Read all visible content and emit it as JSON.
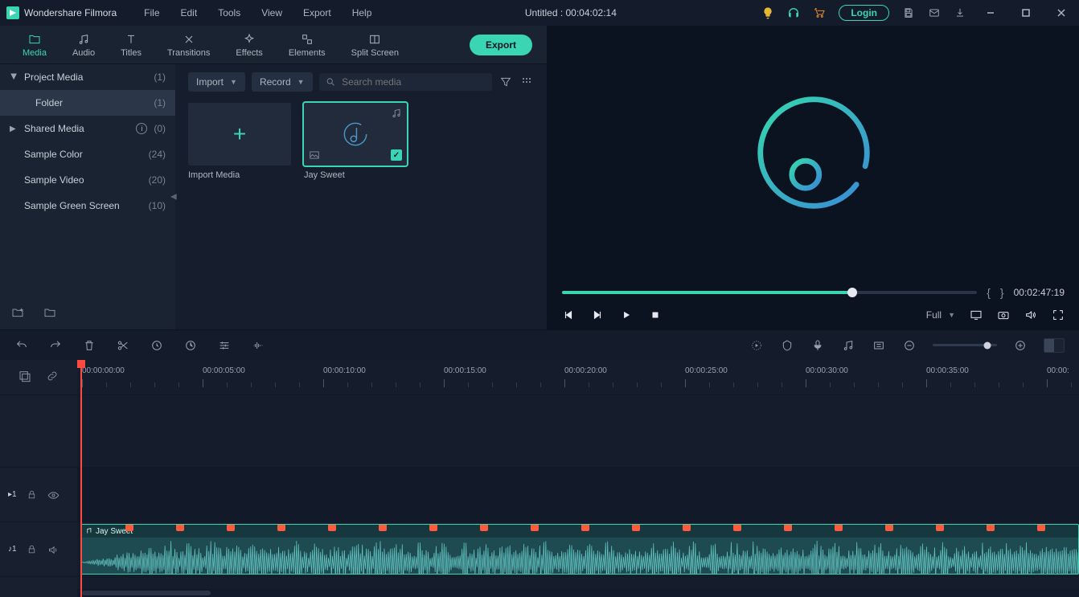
{
  "app": {
    "name": "Wondershare Filmora"
  },
  "menus": [
    "File",
    "Edit",
    "Tools",
    "View",
    "Export",
    "Help"
  ],
  "title_center": "Untitled : 00:04:02:14",
  "login_label": "Login",
  "tabs": [
    {
      "id": "media",
      "label": "Media"
    },
    {
      "id": "audio",
      "label": "Audio"
    },
    {
      "id": "titles",
      "label": "Titles"
    },
    {
      "id": "transitions",
      "label": "Transitions"
    },
    {
      "id": "effects",
      "label": "Effects"
    },
    {
      "id": "elements",
      "label": "Elements"
    },
    {
      "id": "split",
      "label": "Split Screen"
    }
  ],
  "active_tab": "media",
  "export_label": "Export",
  "tree": {
    "project": {
      "label": "Project Media",
      "count": "(1)"
    },
    "folder": {
      "label": "Folder",
      "count": "(1)"
    },
    "shared": {
      "label": "Shared Media",
      "count": "(0)"
    },
    "sample_color": {
      "label": "Sample Color",
      "count": "(24)"
    },
    "sample_video": {
      "label": "Sample Video",
      "count": "(20)"
    },
    "sample_green": {
      "label": "Sample Green Screen",
      "count": "(10)"
    }
  },
  "browser": {
    "import_label": "Import",
    "record_label": "Record",
    "search_placeholder": "Search media",
    "import_media_label": "Import Media",
    "clip_name": "Jay Sweet"
  },
  "preview": {
    "timecode": "00:02:47:19",
    "quality": "Full"
  },
  "ruler_ticks": [
    "00:00:00:00",
    "00:00:05:00",
    "00:00:10:00",
    "00:00:15:00",
    "00:00:20:00",
    "00:00:25:00",
    "00:00:30:00",
    "00:00:35:00",
    "00:00:"
  ],
  "tracks": {
    "video1": "1",
    "audio1": "1"
  },
  "clip_title": "Jay Sweet"
}
